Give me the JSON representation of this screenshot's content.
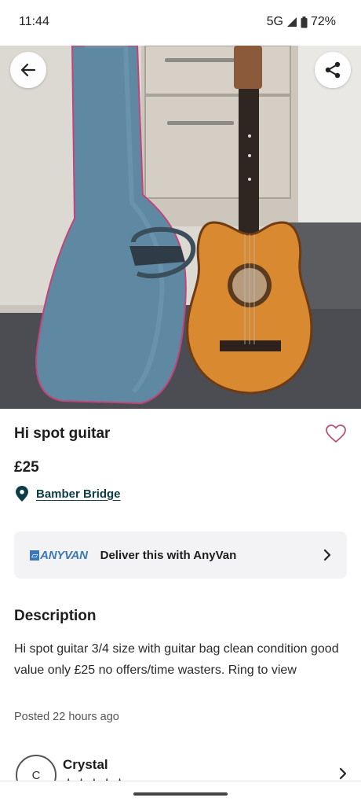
{
  "status_bar": {
    "time": "11:44",
    "network": "5G",
    "battery": "72%"
  },
  "photo": {
    "back_icon": "arrow-left-icon",
    "share_icon": "share-icon"
  },
  "listing": {
    "title": "Hi spot guitar",
    "price": "£25",
    "location": "Bamber Bridge",
    "favourite_icon": "heart-outline-icon"
  },
  "delivery": {
    "logo_text": "ANYVAN",
    "label": "Deliver this with AnyVan"
  },
  "description": {
    "heading": "Description",
    "body": "Hi spot guitar 3/4 size with guitar bag clean condition good value only £25 no offers/time wasters. Ring to view",
    "posted": "Posted 22 hours ago"
  },
  "seller": {
    "initial": "C",
    "name": "Crystal",
    "rating_stars": "★★★★★"
  },
  "colors": {
    "accent": "#0d3c47",
    "heart": "#b8527a",
    "anyvan_blue": "#3a78b8",
    "card_bg": "#f3f3f5"
  }
}
